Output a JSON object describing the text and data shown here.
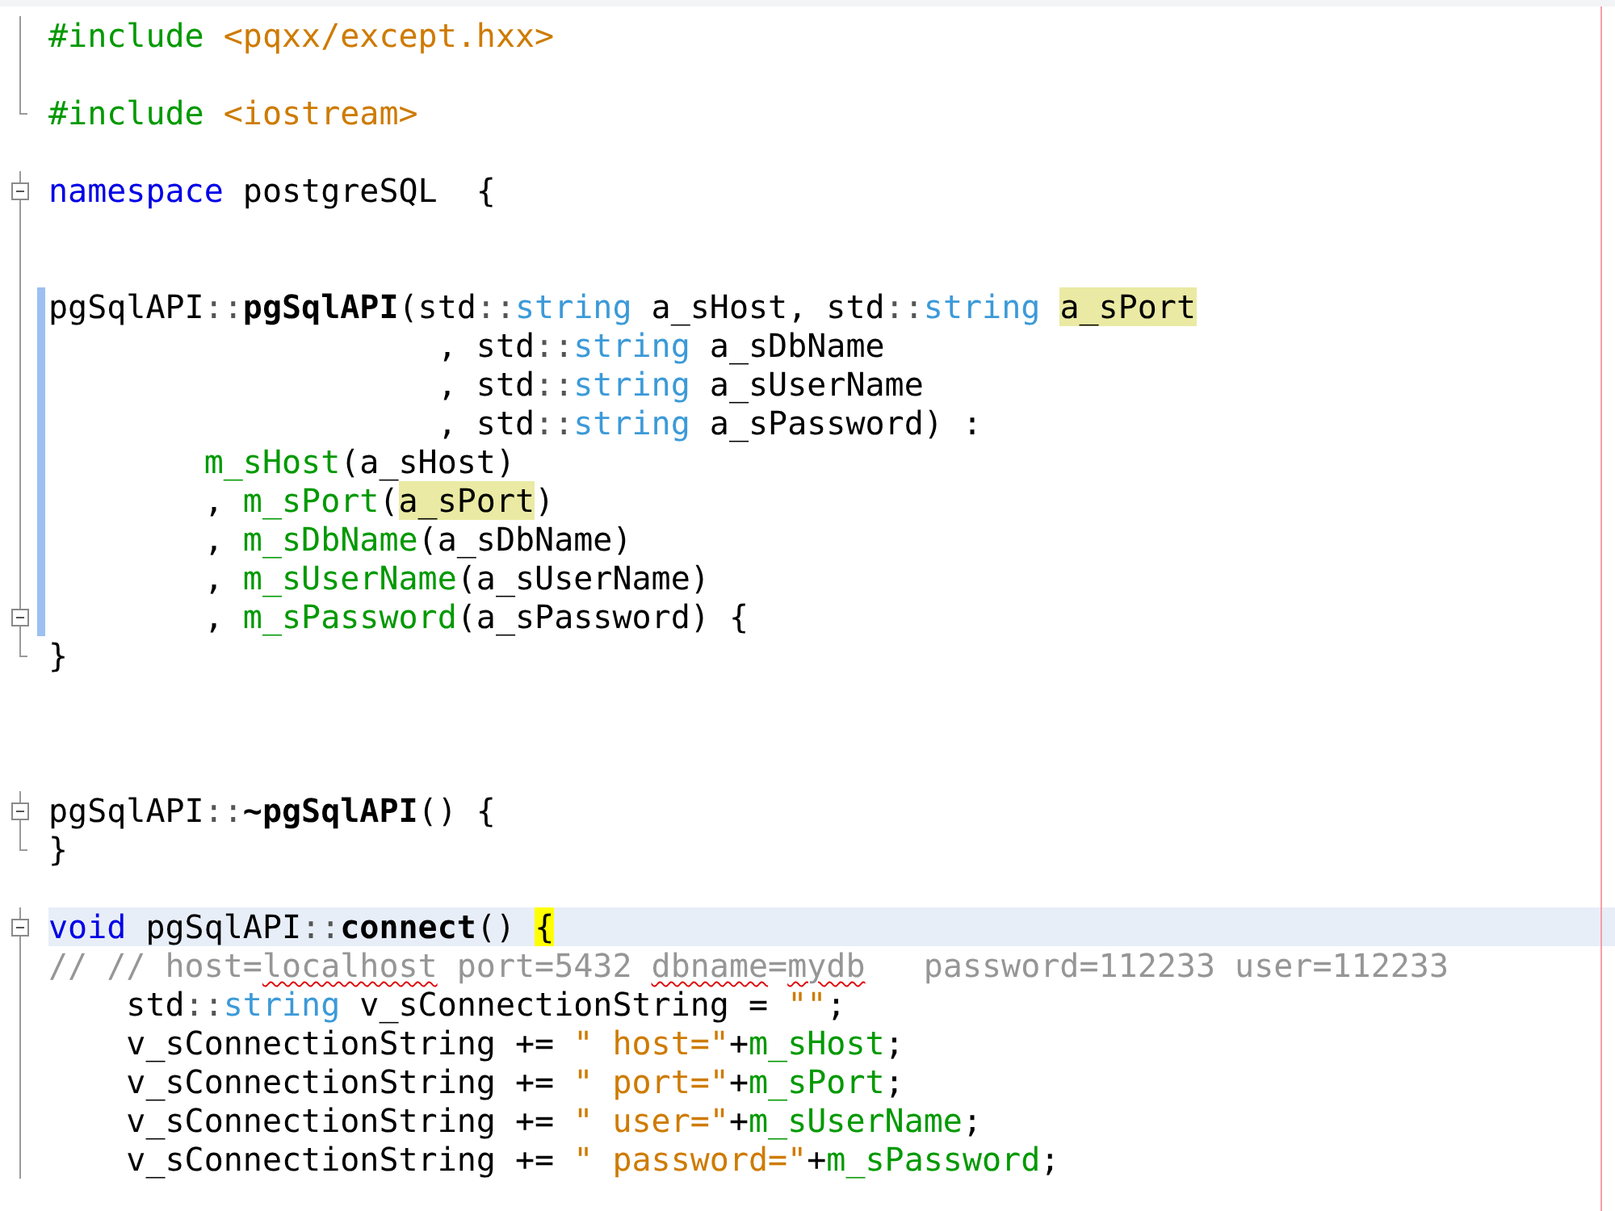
{
  "editor": {
    "lines": [
      {
        "fold_start": false,
        "fold_end": false,
        "changed": false,
        "current": false,
        "tokens": [
          {
            "t": "#include ",
            "kind": "directive"
          },
          {
            "t": "<pqxx/except.hxx>",
            "kind": "string"
          }
        ]
      },
      {
        "fold_start": false,
        "fold_end": false,
        "changed": false,
        "current": false
      },
      {
        "fold_start": false,
        "fold_end": true,
        "changed": false,
        "current": false,
        "tokens": [
          {
            "t": "#include ",
            "kind": "directive"
          },
          {
            "t": "<iostream>",
            "kind": "string"
          }
        ]
      },
      {
        "fold_start": false,
        "fold_end": false,
        "changed": false,
        "current": false
      },
      {
        "fold_start": true,
        "fold_end": false,
        "changed": false,
        "current": false,
        "tokens": [
          {
            "t": "namespace",
            "kind": "keyword"
          },
          {
            "t": " postgreSQL  {",
            "kind": "plain"
          }
        ]
      },
      {
        "fold_start": false,
        "fold_end": false,
        "changed": false,
        "current": false
      },
      {
        "fold_start": false,
        "fold_end": false,
        "changed": false,
        "current": false
      },
      {
        "fold_start": false,
        "fold_end": false,
        "changed": true,
        "current": false,
        "tokens": [
          {
            "t": "pgSqlAPI",
            "kind": "plain"
          },
          {
            "t": "::",
            "kind": "punct"
          },
          {
            "t": "pgSqlAPI",
            "kind": "bold"
          },
          {
            "t": "(std",
            "kind": "plain"
          },
          {
            "t": "::",
            "kind": "punct"
          },
          {
            "t": "string",
            "kind": "type"
          },
          {
            "t": " a_sHost, std",
            "kind": "plain"
          },
          {
            "t": "::",
            "kind": "punct"
          },
          {
            "t": "string ",
            "kind": "type"
          },
          {
            "t": "a_sPort",
            "kind": "highlight"
          }
        ]
      },
      {
        "fold_start": false,
        "fold_end": false,
        "changed": true,
        "current": false,
        "tokens": [
          {
            "t": "                    , std",
            "kind": "plain"
          },
          {
            "t": "::",
            "kind": "punct"
          },
          {
            "t": "string",
            "kind": "type"
          },
          {
            "t": " a_sDbName",
            "kind": "plain"
          }
        ]
      },
      {
        "fold_start": false,
        "fold_end": false,
        "changed": true,
        "current": false,
        "tokens": [
          {
            "t": "                    , std",
            "kind": "plain"
          },
          {
            "t": "::",
            "kind": "punct"
          },
          {
            "t": "string",
            "kind": "type"
          },
          {
            "t": " a_sUserName",
            "kind": "plain"
          }
        ]
      },
      {
        "fold_start": false,
        "fold_end": false,
        "changed": true,
        "current": false,
        "tokens": [
          {
            "t": "                    , std",
            "kind": "plain"
          },
          {
            "t": "::",
            "kind": "punct"
          },
          {
            "t": "string",
            "kind": "type"
          },
          {
            "t": " a_sPassword) :",
            "kind": "plain"
          }
        ]
      },
      {
        "fold_start": false,
        "fold_end": false,
        "changed": true,
        "current": false,
        "tokens": [
          {
            "t": "        m_sHost",
            "kind": "member"
          },
          {
            "t": "(a_sHost)",
            "kind": "plain"
          }
        ]
      },
      {
        "fold_start": false,
        "fold_end": false,
        "changed": true,
        "current": false,
        "tokens": [
          {
            "t": "        , ",
            "kind": "plain"
          },
          {
            "t": "m_sPort",
            "kind": "member"
          },
          {
            "t": "(",
            "kind": "plain"
          },
          {
            "t": "a_sPort",
            "kind": "highlight"
          },
          {
            "t": ")",
            "kind": "plain"
          }
        ]
      },
      {
        "fold_start": false,
        "fold_end": false,
        "changed": true,
        "current": false,
        "tokens": [
          {
            "t": "        , ",
            "kind": "plain"
          },
          {
            "t": "m_sDbName",
            "kind": "member"
          },
          {
            "t": "(a_sDbName)",
            "kind": "plain"
          }
        ]
      },
      {
        "fold_start": false,
        "fold_end": false,
        "changed": true,
        "current": false,
        "tokens": [
          {
            "t": "        , ",
            "kind": "plain"
          },
          {
            "t": "m_sUserName",
            "kind": "member"
          },
          {
            "t": "(a_sUserName)",
            "kind": "plain"
          }
        ]
      },
      {
        "fold_start": true,
        "fold_end": false,
        "changed": true,
        "current": false,
        "tokens": [
          {
            "t": "        , ",
            "kind": "plain"
          },
          {
            "t": "m_sPassword",
            "kind": "member"
          },
          {
            "t": "(a_sPassword) {",
            "kind": "plain"
          }
        ]
      },
      {
        "fold_start": false,
        "fold_end": true,
        "changed": false,
        "current": false,
        "tokens": [
          {
            "t": "}",
            "kind": "plain"
          }
        ]
      },
      {
        "fold_start": false,
        "fold_end": false,
        "changed": false,
        "current": false
      },
      {
        "fold_start": false,
        "fold_end": false,
        "changed": false,
        "current": false
      },
      {
        "fold_start": false,
        "fold_end": false,
        "changed": false,
        "current": false
      },
      {
        "fold_start": true,
        "fold_end": false,
        "changed": false,
        "current": false,
        "tokens": [
          {
            "t": "pgSqlAPI",
            "kind": "plain"
          },
          {
            "t": "::",
            "kind": "punct"
          },
          {
            "t": "~pgSqlAPI",
            "kind": "bold"
          },
          {
            "t": "() {",
            "kind": "plain"
          }
        ]
      },
      {
        "fold_start": false,
        "fold_end": true,
        "changed": false,
        "current": false,
        "tokens": [
          {
            "t": "}",
            "kind": "plain"
          }
        ]
      },
      {
        "fold_start": false,
        "fold_end": false,
        "changed": false,
        "current": false
      },
      {
        "fold_start": true,
        "fold_end": false,
        "changed": false,
        "current": true,
        "tokens": [
          {
            "t": "void",
            "kind": "keyword"
          },
          {
            "t": " pgSqlAPI",
            "kind": "plain"
          },
          {
            "t": "::",
            "kind": "punct"
          },
          {
            "t": "connect",
            "kind": "bold"
          },
          {
            "t": "() ",
            "kind": "plain"
          },
          {
            "t": "{",
            "kind": "brace_match"
          }
        ]
      },
      {
        "fold_start": false,
        "fold_end": false,
        "changed": false,
        "current": false,
        "tokens": [
          {
            "t": "// // host=",
            "kind": "comment"
          },
          {
            "t": "localhost",
            "kind": "misspelled"
          },
          {
            "t": " port=5432 ",
            "kind": "comment"
          },
          {
            "t": "dbname",
            "kind": "misspelled"
          },
          {
            "t": "=",
            "kind": "comment"
          },
          {
            "t": "mydb",
            "kind": "misspelled"
          },
          {
            "t": "   password=112233 user=112233",
            "kind": "comment"
          }
        ]
      },
      {
        "fold_start": false,
        "fold_end": false,
        "changed": false,
        "current": false,
        "tokens": [
          {
            "t": "    std",
            "kind": "plain"
          },
          {
            "t": "::",
            "kind": "punct"
          },
          {
            "t": "string",
            "kind": "type"
          },
          {
            "t": " v_sConnectionString = ",
            "kind": "plain"
          },
          {
            "t": "\"\"",
            "kind": "string"
          },
          {
            "t": ";",
            "kind": "plain"
          }
        ]
      },
      {
        "fold_start": false,
        "fold_end": false,
        "changed": false,
        "current": false,
        "tokens": [
          {
            "t": "    v_sConnectionString += ",
            "kind": "plain"
          },
          {
            "t": "\" host=\"",
            "kind": "string"
          },
          {
            "t": "+",
            "kind": "plain"
          },
          {
            "t": "m_sHost",
            "kind": "member"
          },
          {
            "t": ";",
            "kind": "plain"
          }
        ]
      },
      {
        "fold_start": false,
        "fold_end": false,
        "changed": false,
        "current": false,
        "tokens": [
          {
            "t": "    v_sConnectionString += ",
            "kind": "plain"
          },
          {
            "t": "\" port=\"",
            "kind": "string"
          },
          {
            "t": "+",
            "kind": "plain"
          },
          {
            "t": "m_sPort",
            "kind": "member"
          },
          {
            "t": ";",
            "kind": "plain"
          }
        ]
      },
      {
        "fold_start": false,
        "fold_end": false,
        "changed": false,
        "current": false,
        "tokens": [
          {
            "t": "    v_sConnectionString += ",
            "kind": "plain"
          },
          {
            "t": "\" user=\"",
            "kind": "string"
          },
          {
            "t": "+",
            "kind": "plain"
          },
          {
            "t": "m_sUserName",
            "kind": "member"
          },
          {
            "t": ";",
            "kind": "plain"
          }
        ]
      },
      {
        "fold_start": false,
        "fold_end": false,
        "changed": false,
        "current": false,
        "tokens": [
          {
            "t": "    v_sConnectionString += ",
            "kind": "plain"
          },
          {
            "t": "\" password=\"",
            "kind": "string"
          },
          {
            "t": "+",
            "kind": "plain"
          },
          {
            "t": "m_sPassword",
            "kind": "member"
          },
          {
            "t": ";",
            "kind": "plain"
          }
        ]
      }
    ]
  }
}
